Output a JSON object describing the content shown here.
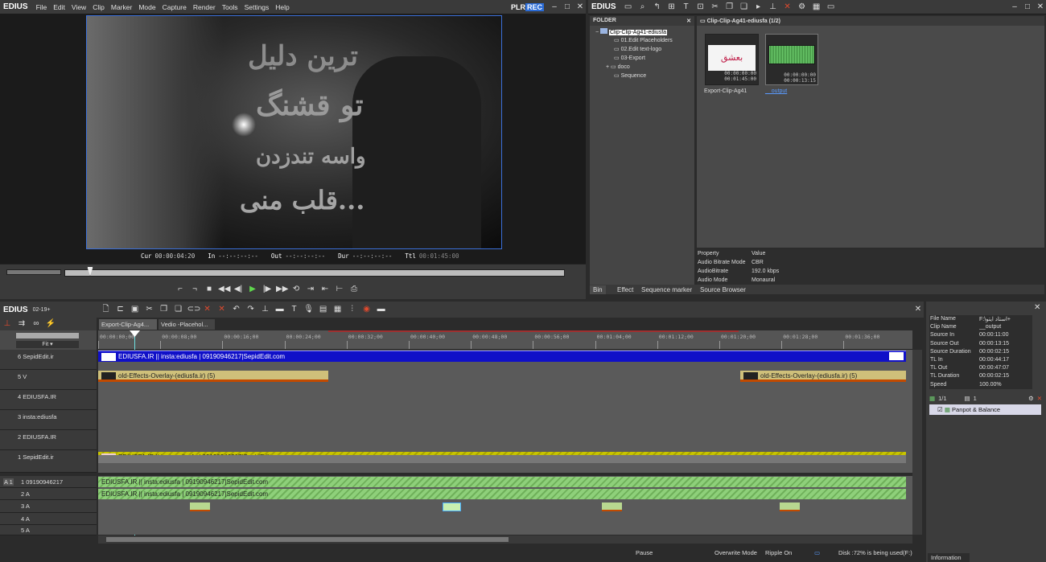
{
  "player": {
    "logo": "EDIUS",
    "menu": [
      "File",
      "Edit",
      "View",
      "Clip",
      "Marker",
      "Mode",
      "Capture",
      "Render",
      "Tools",
      "Settings",
      "Help"
    ],
    "plr": "PLR",
    "rec": "REC",
    "timecodes": {
      "cur_label": "Cur",
      "cur": "00:00:04:20",
      "in_label": "In",
      "in": "--:--:--:--",
      "out_label": "Out",
      "out": "--:--:--:--",
      "dur_label": "Dur",
      "dur": "--:--:--:--",
      "ttl_label": "Ttl",
      "ttl": "00:01:45:00"
    },
    "overlay_text_1": "ترین دلیل",
    "overlay_text_2": "تو قشنگ",
    "overlay_text_3": "واسه تندزدن",
    "overlay_text_4": "قلب منی..."
  },
  "bin": {
    "logo": "EDIUS",
    "folder_label": "FOLDER",
    "root": "Clip-Clip-Ag41-ediusfa",
    "children": [
      "01.Edit Placeholders",
      "02.Edit text-logo",
      "03-Export",
      "doco",
      "Sequence"
    ],
    "path": "Clip-Clip-Ag41-ediusfa (1/2)",
    "clips": [
      {
        "name": "Export-Clip-Ag41",
        "tc1": "00:00:00:00",
        "tc2": "00:01:45:00",
        "thumb_text": "بعشق"
      },
      {
        "name": "__output",
        "tc1": "00:00:00:00",
        "tc2": "00:00:13:15"
      }
    ],
    "property_header": {
      "property": "Property",
      "value": "Value"
    },
    "properties": [
      {
        "property": "Audio Bitrate Mode",
        "value": "CBR"
      },
      {
        "property": "AudioBitrate",
        "value": "192.0 kbps"
      },
      {
        "property": "Audio Mode",
        "value": "Monaural"
      }
    ],
    "tabs": [
      "Bin",
      "Effect",
      "Sequence marker",
      "Source Browser"
    ]
  },
  "timeline": {
    "logo": "EDIUS",
    "version": "02-19+",
    "sequence_tabs": [
      "Export-Clip-Ag4...",
      "Vedio -Placehol..."
    ],
    "fit_label": "Fit",
    "ruler": [
      "00:00:00;00",
      "00:00:08;00",
      "00:00:16;00",
      "00:00:24;00",
      "00:00:32;00",
      "00:00:40;00",
      "00:00:48;00",
      "00:00:56;00",
      "00:01:04;00",
      "00:01:12;00",
      "00:01:20;00",
      "00:01:28;00",
      "00:01:36;00"
    ],
    "video_tracks": [
      {
        "label": "6 SepidEdit.ir"
      },
      {
        "label": "5 V"
      },
      {
        "label": "4 EDIUSFA.IR"
      },
      {
        "label": "3 insta:ediusfa"
      },
      {
        "label": "2 EDIUSFA.IR"
      },
      {
        "label": "1 SepidEdit.ir"
      }
    ],
    "audio_tracks": [
      {
        "label": "1 09190946217"
      },
      {
        "label": "2 A"
      },
      {
        "label": "3 A"
      },
      {
        "label": "4 A"
      },
      {
        "label": "5 A"
      }
    ],
    "a1_label": "A 1",
    "clip_text_title": "EDIUSFA.IR || insta:ediusfa |  09190946217|SepidEdit.com",
    "clip_overlay_1": "old-Effects-Overlay-(ediusfa.ir) (5)",
    "clip_overlay_2": "old-Effects-Overlay-(ediusfa.ir) (5)",
    "clip_v1": "EDIUSFA.IR || insta:ediusfa |  09190946217|SepidEdit.com",
    "clip_a1": "EDIUSFA.IR || insta:ediusfa |  09190946217|SepidEdit.com",
    "clip_a2": "EDIUSFA.IR || insta:ediusfa |  09190946217|SepidEdit.com"
  },
  "info": {
    "rows": [
      {
        "k": "File Name",
        "v": "F:\\استاد ایتو+"
      },
      {
        "k": "Clip Name",
        "v": "__output"
      },
      {
        "k": "Source In",
        "v": "00:00:11:00"
      },
      {
        "k": "Source Out",
        "v": "00:00:13:15"
      },
      {
        "k": "Source Duration",
        "v": "00:00:02:15"
      },
      {
        "k": "TL In",
        "v": "00:00:44:17"
      },
      {
        "k": "TL Out",
        "v": "00:00:47:07"
      },
      {
        "k": "TL Duration",
        "v": "00:00:02:15"
      },
      {
        "k": "Speed",
        "v": "100.00%"
      }
    ],
    "count": "1/1",
    "filters": "1",
    "effect": "Panpot & Balance",
    "tab": "Information"
  },
  "status": {
    "pause": "Pause",
    "overwrite": "Overwrite Mode",
    "ripple": "Ripple On",
    "disk": "Disk :72% is being used(F:)"
  }
}
